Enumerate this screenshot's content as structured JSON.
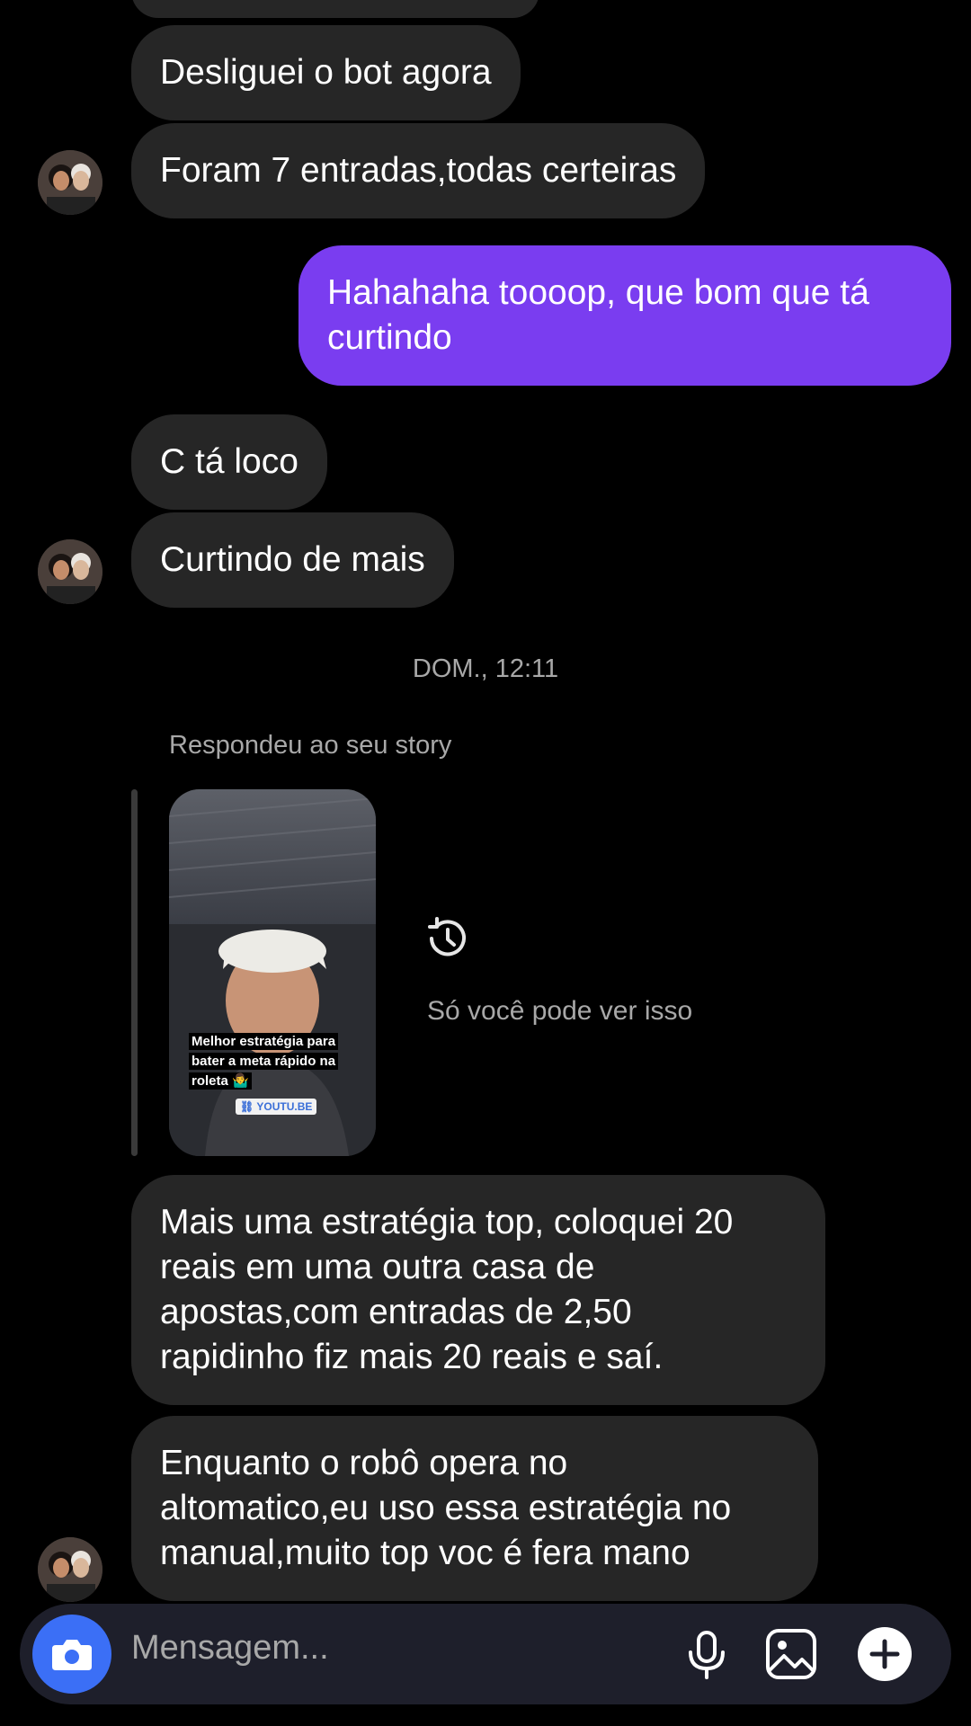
{
  "messages": {
    "m1": "Desliguei o bot agora",
    "m2": "Foram 7 entradas,todas certeiras",
    "m3": "Hahahaha toooop, que bom que tá\ncurtindo",
    "m4": "C tá loco",
    "m5": "Curtindo de mais",
    "m6": "Mais uma estratégia top, coloquei 20\nreais em uma outra casa de\napostas,com entradas de 2,50\nrapidinho fiz mais 20 reais e saí.",
    "m7": "Enquanto o robô opera no\naltomatico,eu uso essa estratégia no\nmanual,muito top voc é fera mano"
  },
  "timestamp": "DOM., 12:11",
  "story_reply": {
    "label": "Respondeu ao seu story",
    "caption_lines": [
      "Melhor estratégia para",
      "bater a meta rápido na",
      "roleta 🤷‍♂️"
    ],
    "link": "YOUTU.BE",
    "private_note": "Só você pode ver isso",
    "icon": "history-icon"
  },
  "composer": {
    "placeholder": "Mensagem...",
    "icons": [
      "camera-icon",
      "microphone-icon",
      "gallery-icon",
      "plus-icon"
    ]
  },
  "colors": {
    "background": "#000000",
    "incoming_bubble": "#262626",
    "outgoing_bubble": "#7a3df0",
    "camera_button": "#3b6ff6",
    "secondary_text": "#a8a8a8"
  }
}
